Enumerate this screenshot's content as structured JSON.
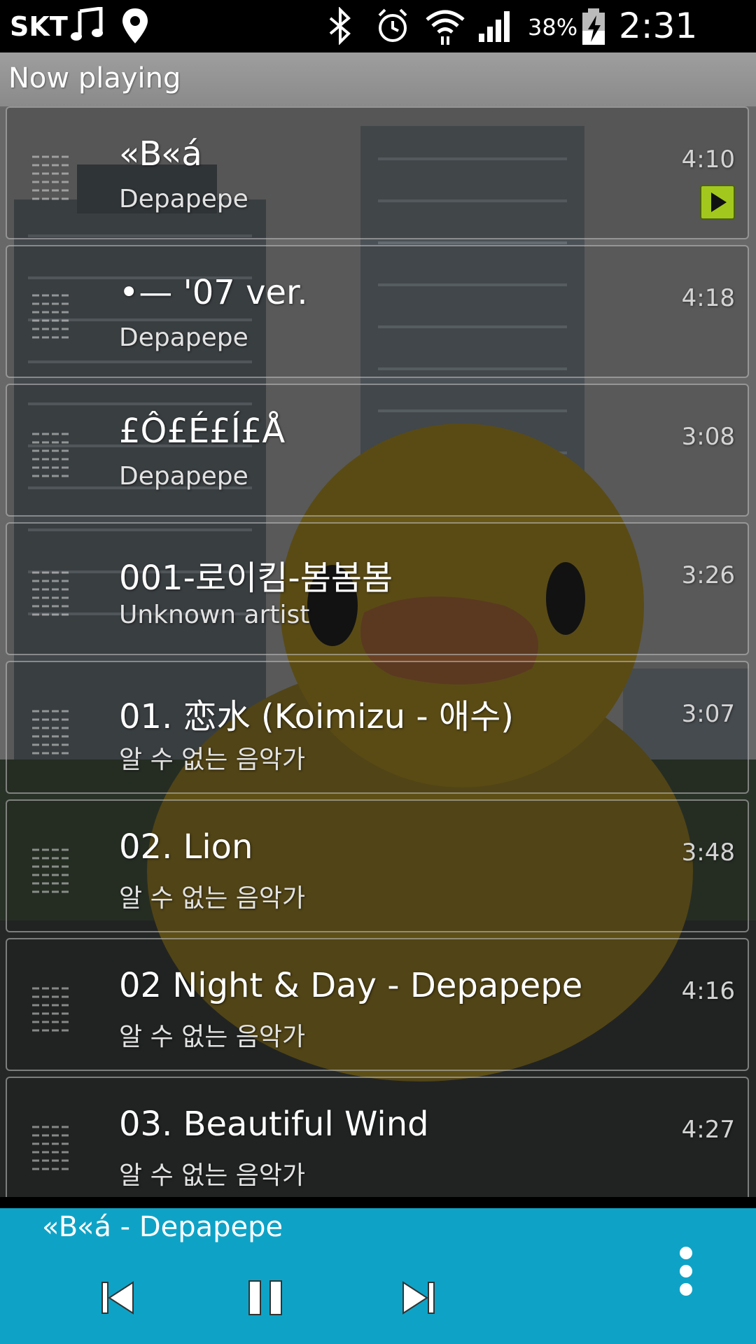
{
  "status_bar": {
    "carrier": "SKT",
    "battery_percent": "38%",
    "time": "2:31 PM",
    "icons": [
      "music-note-icon",
      "location-pin-icon",
      "bluetooth-icon",
      "alarm-icon",
      "wifi-icon",
      "signal-icon",
      "battery-charging-icon"
    ]
  },
  "header": {
    "title": "Now playing"
  },
  "tracks": [
    {
      "title": "«B«á",
      "artist": "Depapepe",
      "duration": "4:10",
      "is_current": true
    },
    {
      "title": "•— '07 ver.",
      "artist": "Depapepe",
      "duration": "4:18"
    },
    {
      "title": "£Ô£É£Í£Å",
      "artist": "Depapepe",
      "duration": "3:08"
    },
    {
      "title": "001-로이킴-봄봄봄",
      "artist": "Unknown artist",
      "duration": "3:26"
    },
    {
      "title": "01. 恋水 (Koimizu - 애수)",
      "artist": "알 수 없는 음악가",
      "duration": "3:07"
    },
    {
      "title": "02. Lion",
      "artist": "알 수 없는 음악가",
      "duration": "3:48"
    },
    {
      "title": "02 Night & Day - Depapepe",
      "artist": "알 수 없는 음악가",
      "duration": "4:16"
    },
    {
      "title": "03. Beautiful Wind",
      "artist": "알 수 없는 음악가",
      "duration": "4:27"
    }
  ],
  "mini_player": {
    "now_playing": "«B«á - Depapepe",
    "controls": [
      "previous-icon",
      "pause-icon",
      "next-icon",
      "more-options-icon"
    ]
  },
  "colors": {
    "mini_player_bg": "#0ea3c6",
    "playing_indicator": "#a2c81e"
  }
}
